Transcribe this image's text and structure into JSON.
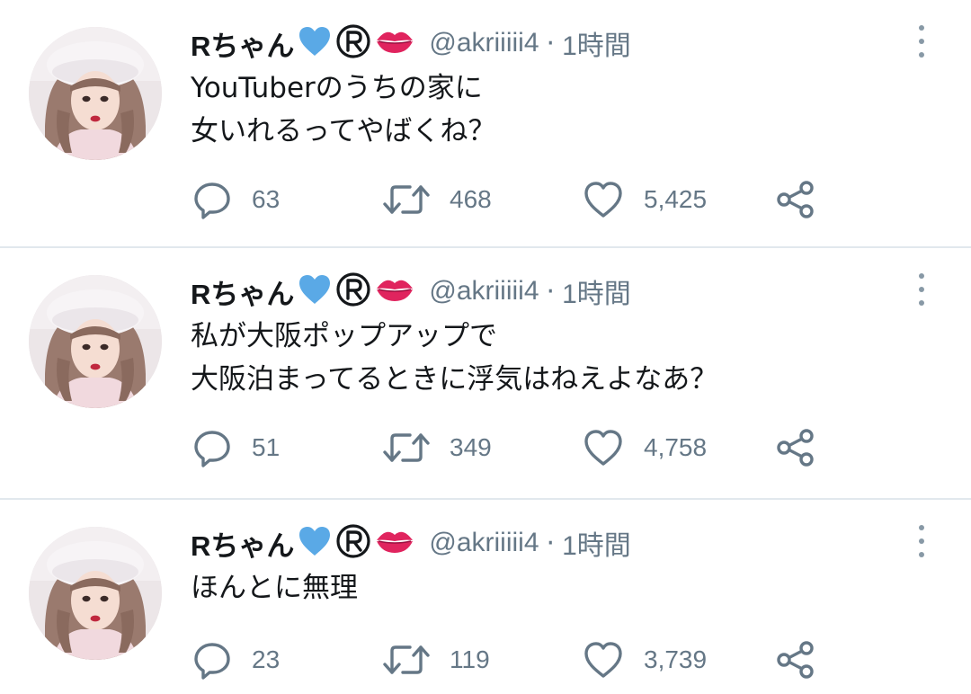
{
  "colors": {
    "text": "#14171a",
    "secondary": "#657786",
    "icon": "#657786",
    "divider": "#e1e8ed",
    "heart_blue": "#5aa9e6",
    "lips": "#e0245e"
  },
  "tweets": [
    {
      "name": "Rちゃん",
      "emojis": [
        "blue-heart-icon",
        "registered-icon",
        "lips-icon"
      ],
      "handle": "@akriiiii4",
      "separator": "·",
      "time": "1時間",
      "lines": [
        "YouTuberのうちの家に",
        "女いれるってやばくね？"
      ],
      "reply_count": "63",
      "retweet_count": "468",
      "like_count": "5,425"
    },
    {
      "name": "Rちゃん",
      "emojis": [
        "blue-heart-icon",
        "registered-icon",
        "lips-icon"
      ],
      "handle": "@akriiiii4",
      "separator": "·",
      "time": "1時間",
      "lines": [
        "私が大阪ポップアップで",
        "大阪泊まってるときに浮気はねえよなあ？"
      ],
      "reply_count": "51",
      "retweet_count": "349",
      "like_count": "4,758"
    },
    {
      "name": "Rちゃん",
      "emojis": [
        "blue-heart-icon",
        "registered-icon",
        "lips-icon"
      ],
      "handle": "@akriiiii4",
      "separator": "·",
      "time": "1時間",
      "lines": [
        "ほんとに無理"
      ],
      "reply_count": "23",
      "retweet_count": "119",
      "like_count": "3,739"
    }
  ]
}
